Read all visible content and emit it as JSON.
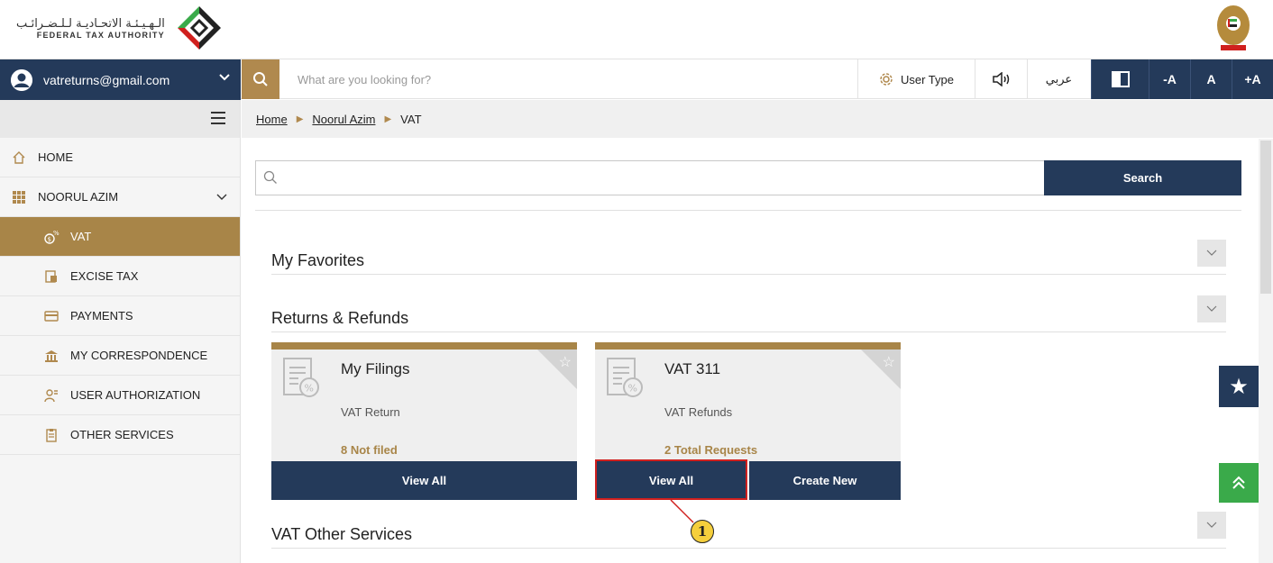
{
  "brand": {
    "arabic_name": "الـهـيـئـة الاتحـاديـة لـلـضـرائـب",
    "english_name": "FEDERAL TAX AUTHORITY"
  },
  "navbar": {
    "user_email": "vatreturns@gmail.com",
    "search_placeholder": "What are you looking for?",
    "user_type_label": "User Type",
    "language_label": "عربي",
    "font_decrease": "-A",
    "font_normal": "A",
    "font_increase": "+A"
  },
  "sidebar": {
    "home": "HOME",
    "group": "NOORUL AZIM",
    "items": [
      {
        "label": "VAT",
        "icon": "vat-icon",
        "active": true
      },
      {
        "label": "EXCISE TAX",
        "icon": "excise-tax-icon",
        "active": false
      },
      {
        "label": "PAYMENTS",
        "icon": "payments-icon",
        "active": false
      },
      {
        "label": "MY CORRESPONDENCE",
        "icon": "correspondence-icon",
        "active": false
      },
      {
        "label": "USER AUTHORIZATION",
        "icon": "user-authorization-icon",
        "active": false
      },
      {
        "label": "OTHER SERVICES",
        "icon": "other-services-icon",
        "active": false
      }
    ]
  },
  "breadcrumb": {
    "home": "Home",
    "account": "Noorul Azim",
    "current": "VAT"
  },
  "main": {
    "search_button": "Search",
    "sections": {
      "favorites": "My Favorites",
      "returns": "Returns & Refunds",
      "other": "VAT Other Services"
    },
    "cards": [
      {
        "title": "My Filings",
        "subtitle": "VAT Return",
        "status": "8 Not filed",
        "buttons": [
          "View All"
        ]
      },
      {
        "title": "VAT 311",
        "subtitle": "VAT Refunds",
        "status": "2 Total Requests",
        "buttons": [
          "View All",
          "Create New"
        ]
      }
    ]
  },
  "callout": {
    "number": "1"
  },
  "colors": {
    "navy": "#243a5a",
    "gold": "#a88548",
    "green": "#3aaa4a",
    "highlight_red": "#d0201e"
  }
}
